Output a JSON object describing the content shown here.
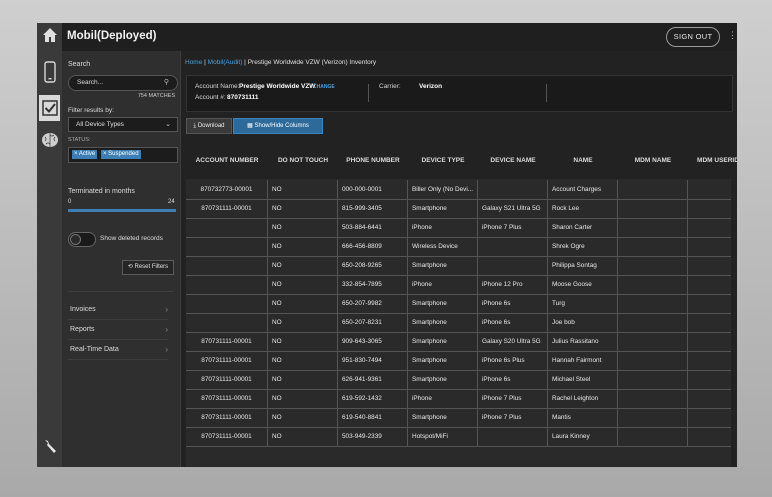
{
  "app": {
    "title": "Mobil(Deployed)",
    "sign_out": "SIGN OUT"
  },
  "rail_icons": [
    "home-icon",
    "phone-icon",
    "checkbox-icon",
    "brain-icon",
    "wrench-icon"
  ],
  "sidebar": {
    "search_label": "Search",
    "search_placeholder": "Search...",
    "matches": "754 MATCHES",
    "filter_label": "Filter results by:",
    "filter_value": "All Device Types",
    "status_label": "STATUS:",
    "status_chips": [
      "× Active",
      "× Suspended"
    ],
    "terminated_label": "Terminated in months",
    "slider_min": "0",
    "slider_max": "24",
    "show_deleted": "Show deleted records",
    "reset": "Reset Filters",
    "nav": [
      "Invoices",
      "Reports",
      "Real-Time Data"
    ]
  },
  "breadcrumb": {
    "home": "Home",
    "sep1": "|",
    "section": "Mobil(Audit)",
    "sep2": "|",
    "page": "Prestige Worldwide VZW (Verizon) Inventory"
  },
  "account": {
    "name_label": "Account Name:",
    "name_value": "Prestige Worldwide VZW",
    "change": "CHANGE",
    "num_label": "Account #:",
    "num_value": "870731111",
    "carrier_label": "Carrier:",
    "carrier_value": "Verizon"
  },
  "toolbar": {
    "download": "Download",
    "columns": "Show/Hide Columns"
  },
  "table": {
    "headers": [
      "ACCOUNT NUMBER",
      "DO NOT TOUCH",
      "PHONE NUMBER",
      "DEVICE TYPE",
      "DEVICE NAME",
      "NAME",
      "MDM NAME",
      "MDM USERID"
    ],
    "rows": [
      [
        "870732773-00001",
        "NO",
        "000-000-0001",
        "Biller Only (No Devi...",
        "",
        "Account Charges",
        "",
        ""
      ],
      [
        "870731111-00001",
        "NO",
        "815-999-3405",
        "Smartphone",
        "Galaxy S21 Ultra 5G",
        "Rock Lee",
        "",
        ""
      ],
      [
        "",
        "NO",
        "503-884-6441",
        "iPhone",
        "iPhone 7 Plus",
        "Sharon Carter",
        "",
        ""
      ],
      [
        "",
        "NO",
        "666-456-8809",
        "Wireless Device",
        "",
        "Shrek Ogre",
        "",
        ""
      ],
      [
        "",
        "NO",
        "650-208-9265",
        "Smartphone",
        "",
        "Philippa Sontag",
        "",
        ""
      ],
      [
        "",
        "NO",
        "332-854-7895",
        "iPhone",
        "iPhone 12 Pro",
        "Moose Goose",
        "",
        ""
      ],
      [
        "",
        "NO",
        "650-207-9982",
        "Smartphone",
        "iPhone 6s",
        "Turg",
        "",
        ""
      ],
      [
        "",
        "NO",
        "650-207-8231",
        "Smartphone",
        "iPhone 6s",
        "Joe bob",
        "",
        ""
      ],
      [
        "870731111-00001",
        "NO",
        "909-643-3065",
        "Smartphone",
        "Galaxy S20 Ultra 5G",
        "Julius Rassitano",
        "",
        ""
      ],
      [
        "870731111-00001",
        "NO",
        "951-830-7494",
        "Smartphone",
        "iPhone 6s Plus",
        "Hannah Fairmont",
        "",
        ""
      ],
      [
        "870731111-00001",
        "NO",
        "626-941-9361",
        "Smartphone",
        "iPhone 6s",
        "Michael Steel",
        "",
        ""
      ],
      [
        "870731111-00001",
        "NO",
        "619-592-1432",
        "iPhone",
        "iPhone 7 Plus",
        "Rachel Leighton",
        "",
        ""
      ],
      [
        "870731111-00001",
        "NO",
        "619-540-8841",
        "Smartphone",
        "iPhone 7 Plus",
        "Mantis",
        "",
        ""
      ],
      [
        "870731111-00001",
        "NO",
        "503-949-2339",
        "Hotspot/MiFi",
        "",
        "Laura Kinney",
        "",
        ""
      ]
    ]
  }
}
